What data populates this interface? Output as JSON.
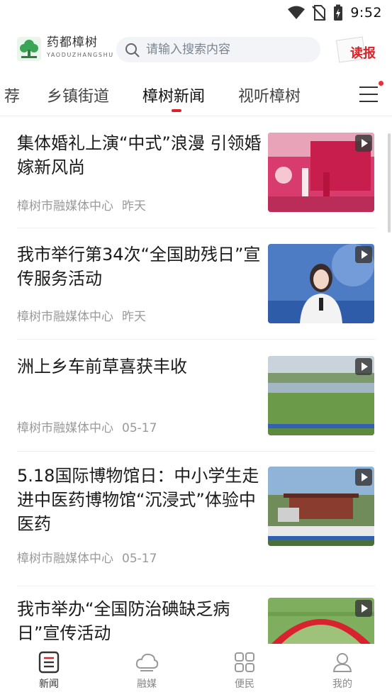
{
  "status": {
    "time": "9:52"
  },
  "header": {
    "brand_name": "药都樟树",
    "brand_pinyin": "YAODUZHANGSHU",
    "search_placeholder": "请输入搜索内容",
    "read_label": "读报"
  },
  "tabs": [
    "荐",
    "乡镇街道",
    "樟树新闻",
    "视听樟树"
  ],
  "active_tab": "樟树新闻",
  "news": [
    {
      "title": "集体婚礼上演“中式”浪漫  引领婚嫁新风尚",
      "source": "樟树市融媒体中心",
      "time": "昨天",
      "video": true
    },
    {
      "title": "我市举行第34次“全国助残日”宣传服务活动",
      "source": "樟树市融媒体中心",
      "time": "昨天",
      "video": true
    },
    {
      "title": "洲上乡车前草喜获丰收",
      "source": "樟树市融媒体中心",
      "time": "05-17",
      "video": true
    },
    {
      "title": "5.18国际博物馆日：中小学生走进中医药博物馆“沉浸式”体验中医药",
      "source": "樟树市融媒体中心",
      "time": "05-17",
      "video": true
    },
    {
      "title": "我市举办“全国防治碘缺乏病日”宣传活动",
      "source": "",
      "time": "",
      "video": true
    }
  ],
  "nav": [
    {
      "label": "新闻",
      "icon": "news-icon"
    },
    {
      "label": "融媒",
      "icon": "cloud-icon"
    },
    {
      "label": "便民",
      "icon": "grid-icon"
    },
    {
      "label": "我的",
      "icon": "user-icon"
    }
  ],
  "colors": {
    "accent": "#d9232a",
    "brand_green": "#3aa655"
  }
}
